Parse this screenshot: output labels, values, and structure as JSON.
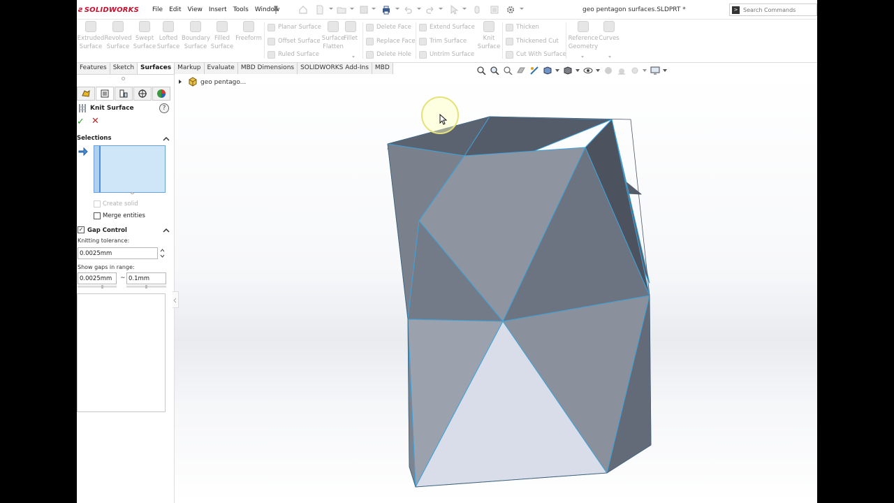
{
  "app": {
    "brand": "SOLIDWORKS",
    "menus": [
      "File",
      "Edit",
      "View",
      "Insert",
      "Tools",
      "Window"
    ],
    "document_title": "geo pentagon surfaces.SLDPRT *",
    "search_placeholder": "Search Commands"
  },
  "command_manager": {
    "big_tools": [
      "Extruded\nSurface",
      "Revolved\nSurface",
      "Swept\nSurface",
      "Lofted\nSurface",
      "Boundary\nSurface",
      "Filled\nSurface",
      "Freeform"
    ],
    "small_col1": [
      "Planar Surface",
      "Offset Surface",
      "Ruled Surface"
    ],
    "surface_flatten": "Surface\nFlatten",
    "fillet": "Fillet",
    "small_col2": [
      "Delete Face",
      "Replace Face",
      "Delete Hole"
    ],
    "small_col3": [
      "Extend Surface",
      "Trim Surface",
      "Untrim Surface"
    ],
    "knit_surface": "Knit\nSurface",
    "small_col4": [
      "Thicken",
      "Thickened Cut",
      "Cut With Surface"
    ],
    "reference_geometry": "Reference\nGeometry",
    "curves": "Curves"
  },
  "tabs": [
    {
      "label": "Features",
      "active": false
    },
    {
      "label": "Sketch",
      "active": false
    },
    {
      "label": "Surfaces",
      "active": true
    },
    {
      "label": "Markup",
      "active": false
    },
    {
      "label": "Evaluate",
      "active": false
    },
    {
      "label": "MBD Dimensions",
      "active": false
    },
    {
      "label": "SOLIDWORKS Add-Ins",
      "active": false
    },
    {
      "label": "MBD",
      "active": false
    }
  ],
  "feature_tree": {
    "root_label": "geo pentago..."
  },
  "property_manager": {
    "title": "Knit Surface",
    "help": "?",
    "selections_header": "Selections",
    "create_solid_label": "Create solid",
    "create_solid_checked": false,
    "merge_entities_label": "Merge entities",
    "merge_entities_checked": false,
    "gap_control_label": "Gap Control",
    "gap_control_checked": true,
    "knitting_tolerance_label": "Knitting tolerance:",
    "knitting_tolerance_value": "0.0025mm",
    "show_gaps_label": "Show gaps in range:",
    "gap_min_value": "0.0025mm",
    "gap_max_value": "0.1mm",
    "range_separator": "~"
  },
  "colors": {
    "brand_red": "#c8102e",
    "active_tab_bg": "#ffffff",
    "selection_box": "#cfe6f8",
    "model_edge": "#3fa2d8",
    "cursor_highlight": "#fff7a0"
  }
}
